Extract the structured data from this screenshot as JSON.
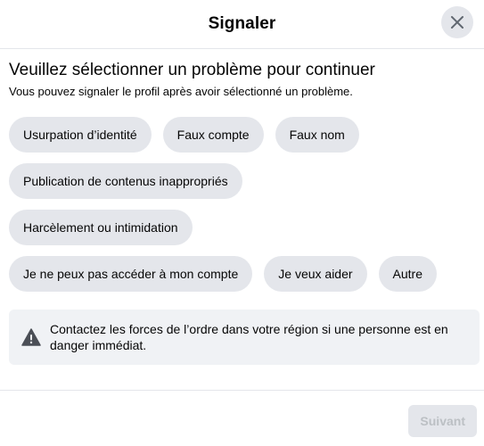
{
  "dialog": {
    "title": "Signaler",
    "close_icon": "close-icon"
  },
  "main": {
    "heading": "Veuillez sélectionner un problème pour continuer",
    "subheading": "Vous pouvez signaler le profil après avoir sélectionné un problème.",
    "options": [
      [
        "Usurpation d’identité",
        "Faux compte",
        "Faux nom"
      ],
      [
        "Publication de contenus inappropriés"
      ],
      [
        "Harcèlement ou intimidation"
      ],
      [
        "Je ne peux pas accéder à mon compte",
        "Je veux aider",
        "Autre"
      ]
    ]
  },
  "notice": {
    "icon": "warning-icon",
    "text": "Contactez les forces de l’ordre dans votre région si une personne est en danger immédiat."
  },
  "footer": {
    "next_label": "Suivant"
  }
}
